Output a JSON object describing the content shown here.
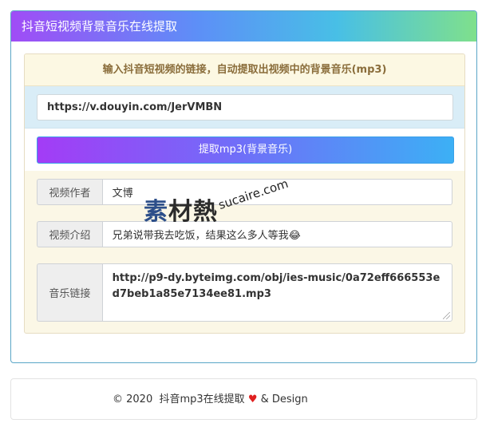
{
  "header": {
    "title": "抖音短视频背景音乐在线提取"
  },
  "notice": {
    "text": "输入抖音短视频的链接，自动提取出视频中的背景音乐(mp3)"
  },
  "url_input": {
    "value": "https://v.douyin.com/JerVMBN"
  },
  "extract_button": {
    "label": "提取mp3(背景音乐)"
  },
  "fields": {
    "author": {
      "label": "视频作者",
      "value": "文博"
    },
    "description": {
      "label": "视频介绍",
      "value": "兄弟说带我去吃饭，结果这么多人等我😂"
    },
    "music_link": {
      "label": "音乐链接",
      "value": "http://p9-dy.byteimg.com/obj/ies-music/0a72eff666553ed7beb1a85e7134ee81.mp3"
    }
  },
  "watermark": {
    "main_su": "素",
    "main_rest": "材熱",
    "sub": "sucaire.com"
  },
  "footer": {
    "copyright": "© 2020",
    "site": "抖音mp3在线提取",
    "heart": "♥",
    "suffix": "& Design"
  },
  "colors": {
    "header_start": "#a04cf6",
    "header_end": "#7fe08c",
    "button_start": "#a33cf6",
    "button_end": "#3cb0f5",
    "heart": "#e02020"
  }
}
